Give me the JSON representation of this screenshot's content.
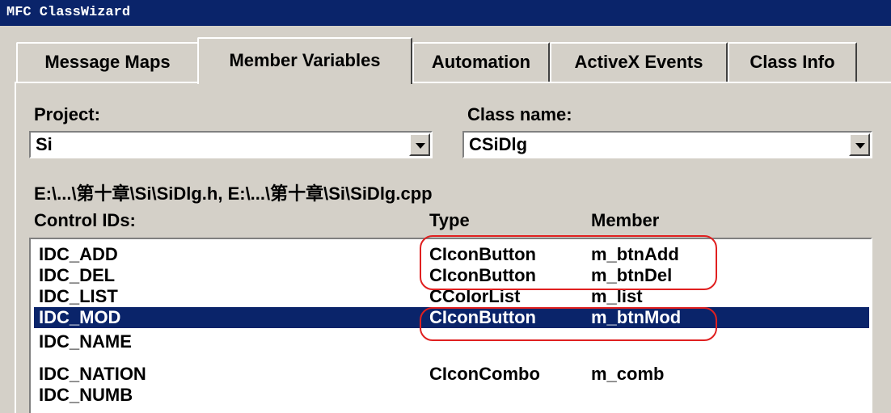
{
  "window": {
    "title": "MFC ClassWizard"
  },
  "tabs": [
    {
      "label": "Message Maps"
    },
    {
      "label": "Member Variables"
    },
    {
      "label": "Automation"
    },
    {
      "label": "ActiveX Events"
    },
    {
      "label": "Class Info"
    }
  ],
  "active_tab": "Member Variables",
  "project": {
    "label": "Project:",
    "value": "Si"
  },
  "class_name": {
    "label": "Class name:",
    "value": "CSiDlg"
  },
  "files_text": "E:\\...\\第十章\\Si\\SiDlg.h, E:\\...\\第十章\\Si\\SiDlg.cpp",
  "columns": {
    "control_ids": "Control IDs:",
    "type": "Type",
    "member": "Member"
  },
  "rows": [
    {
      "id": "IDC_ADD",
      "type": "CIconButton",
      "member": "m_btnAdd"
    },
    {
      "id": "IDC_DEL",
      "type": "CIconButton",
      "member": "m_btnDel"
    },
    {
      "id": "IDC_LIST",
      "type": "CColorList",
      "member": "m_list"
    },
    {
      "id": "IDC_MOD",
      "type": "CIconButton",
      "member": "m_btnMod",
      "selected": true
    },
    {
      "id": "IDC_NAME",
      "type": "",
      "member": ""
    },
    {
      "id": "IDC_NATION",
      "type": "CIconCombo",
      "member": "m_comb"
    },
    {
      "id": "IDC_NUMB",
      "type": "",
      "member": ""
    }
  ],
  "colors": {
    "title_bar": "#0a246a",
    "selection": "#0a246a",
    "face": "#d4d0c8",
    "annotation": "#e02020"
  }
}
